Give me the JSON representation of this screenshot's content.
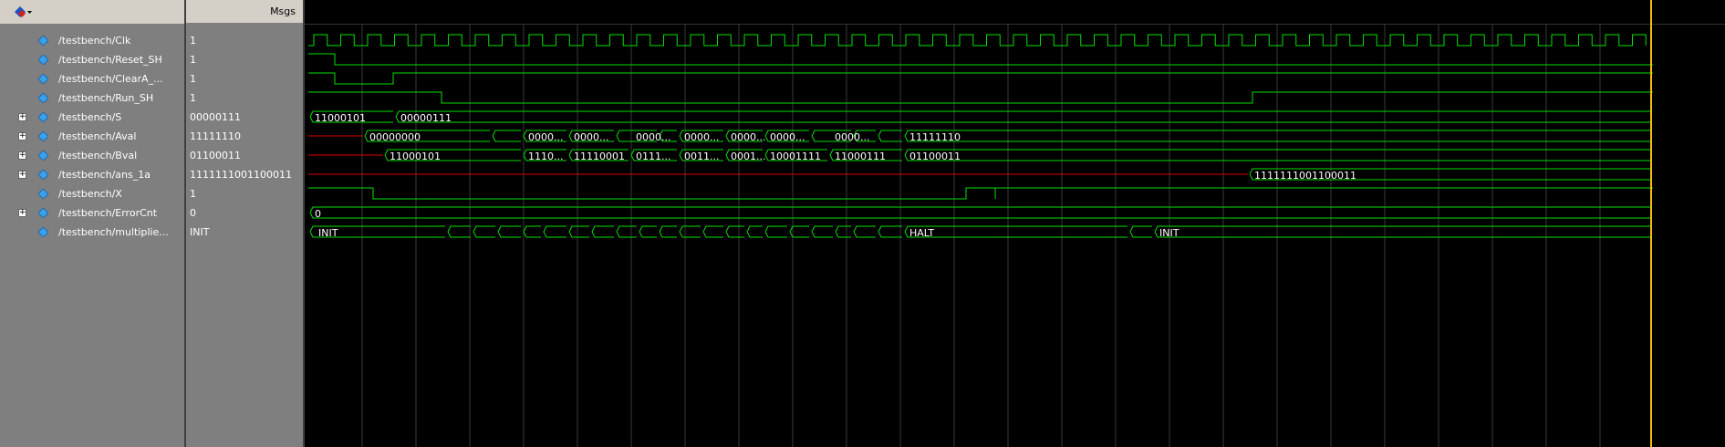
{
  "header": {
    "msgs_label": "Msgs"
  },
  "signals": [
    {
      "name": "/testbench/Clk",
      "value": "1",
      "expandable": false
    },
    {
      "name": "/testbench/Reset_SH",
      "value": "1",
      "expandable": false
    },
    {
      "name": "/testbench/ClearA_...",
      "value": "1",
      "expandable": false
    },
    {
      "name": "/testbench/Run_SH",
      "value": "1",
      "expandable": false
    },
    {
      "name": "/testbench/S",
      "value": "00000111",
      "expandable": true
    },
    {
      "name": "/testbench/Aval",
      "value": "11111110",
      "expandable": true
    },
    {
      "name": "/testbench/Bval",
      "value": "01100011",
      "expandable": true
    },
    {
      "name": "/testbench/ans_1a",
      "value": "1111111001100011",
      "expandable": true
    },
    {
      "name": "/testbench/X",
      "value": "1",
      "expandable": false
    },
    {
      "name": "/testbench/ErrorCnt",
      "value": "0",
      "expandable": true
    },
    {
      "name": "/testbench/multiplie...",
      "value": "INIT",
      "expandable": false
    }
  ],
  "wave_labels": {
    "S": [
      "11000101",
      "00000111"
    ],
    "Aval": [
      "00000000",
      "0000...",
      "0000...",
      "0000...",
      "0000...",
      "0000...",
      "0000...",
      "0000...",
      "11111110"
    ],
    "Bval": [
      "11000101",
      "1110...",
      "11110001",
      "0111...",
      "0011...",
      "0001...",
      "10001111",
      "11000111",
      "01100011"
    ],
    "ans_1a": [
      "1111111001100011"
    ],
    "ErrorCnt": [
      "0"
    ],
    "multiplier": [
      "INIT",
      "HALT",
      "INIT"
    ]
  },
  "colors": {
    "wave": "#00e000",
    "red": "#e00000",
    "cursor": "#f0c000",
    "grid": "#3a3a3a"
  }
}
